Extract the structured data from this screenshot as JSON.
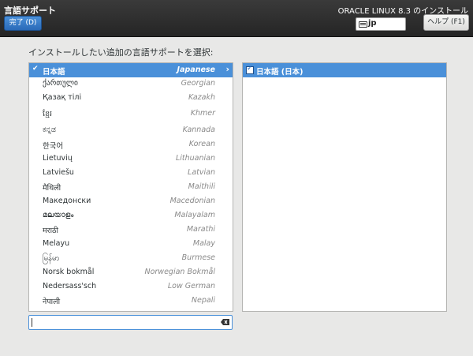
{
  "header": {
    "spoke_title": "言語サポート",
    "done_label": "完了 (D)",
    "product_title": "ORACLE LINUX 8.3 のインストール",
    "keyboard_layout": "jp",
    "help_label": "ヘルプ (F1)"
  },
  "prompt": "インストールしたい追加の言語サポートを選択:",
  "languages": [
    {
      "native": "日本語",
      "english": "Japanese",
      "selected": true
    },
    {
      "native": "ქართული",
      "english": "Georgian"
    },
    {
      "native": "Қазақ тілі",
      "english": "Kazakh"
    },
    {
      "native": "ខ្មែរ",
      "english": "Khmer"
    },
    {
      "native": "ಕನ್ನಡ",
      "english": "Kannada"
    },
    {
      "native": "한국어",
      "english": "Korean"
    },
    {
      "native": "Lietuvių",
      "english": "Lithuanian"
    },
    {
      "native": "Latviešu",
      "english": "Latvian"
    },
    {
      "native": "मैथिली",
      "english": "Maithili"
    },
    {
      "native": "Македонски",
      "english": "Macedonian"
    },
    {
      "native": "മലയാളം",
      "english": "Malayalam"
    },
    {
      "native": "मराठी",
      "english": "Marathi"
    },
    {
      "native": "Melayu",
      "english": "Malay"
    },
    {
      "native": "မြန်မာ",
      "english": "Burmese"
    },
    {
      "native": "Norsk bokmål",
      "english": "Norwegian Bokmål"
    },
    {
      "native": "Nedersass'sch",
      "english": "Low German"
    },
    {
      "native": "नेपाली",
      "english": "Nepali"
    }
  ],
  "locales": [
    {
      "label": "日本語 (日本)",
      "checked": true
    }
  ],
  "search": {
    "value": ""
  },
  "colors": {
    "accent": "#4a90d9",
    "header_bg": "#2d2d2d",
    "page_bg": "#e8e8e7"
  }
}
